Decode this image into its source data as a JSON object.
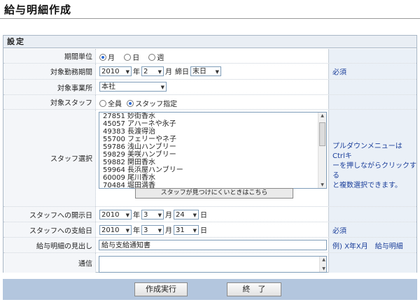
{
  "page": {
    "title": "給与明細作成"
  },
  "section": {
    "title": "設定"
  },
  "period_unit": {
    "label": "期間単位",
    "options": [
      "月",
      "日",
      "週"
    ],
    "selected": "月"
  },
  "target_period": {
    "label": "対象勤務期間",
    "year": "2010",
    "year_unit": "年",
    "month": "2",
    "month_unit": "月",
    "closing_label": "締日",
    "closing_day": "末日",
    "note": "必須"
  },
  "office": {
    "label": "対象事業所",
    "value": "本社"
  },
  "target_staff": {
    "label": "対象スタッフ",
    "options": [
      "全員",
      "スタッフ指定"
    ],
    "selected": "スタッフ指定"
  },
  "staff_select": {
    "label": "スタッフ選択",
    "items": [
      "27851 妙街香水",
      "45057 アハーネや永子",
      "49383 長渡得治",
      "55700 フェリーやネ子",
      "59786 浅山ハンブリー",
      "59829 美咲ハンブリー",
      "59882 関田香水",
      "59964 長浜屋ハンブリー",
      "60009 尾川香水",
      "70484 堀田満香"
    ],
    "find_button": "スタッフが見つけにくいときはこちら",
    "note_lines": [
      "プルダウンメニューは Ctrlキ",
      "ーを押しながらクリックする",
      "と複数選択できます。"
    ]
  },
  "open_date": {
    "label": "スタッフへの開示日",
    "year": "2010",
    "year_unit": "年",
    "month": "3",
    "month_unit": "月",
    "day": "24",
    "day_unit": "日"
  },
  "pay_date": {
    "label": "スタッフへの支給日",
    "year": "2010",
    "year_unit": "年",
    "month": "3",
    "month_unit": "月",
    "day": "31",
    "day_unit": "日",
    "note": "必須"
  },
  "heading": {
    "label": "給与明細の見出し",
    "value": "給与支給通知書",
    "note": "例) X年X月　給与明細"
  },
  "message": {
    "label": "通信",
    "value": ""
  },
  "footer": {
    "run_button": "作成実行",
    "end_button": "終　了"
  }
}
